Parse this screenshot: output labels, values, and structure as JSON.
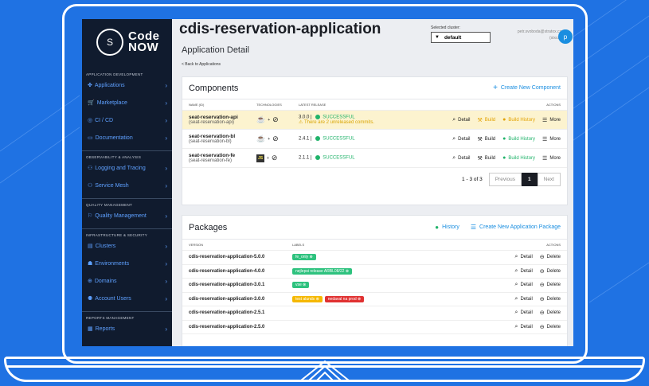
{
  "sidebar": {
    "logo_text_1": "Code",
    "logo_text_2": "NOW",
    "sections": [
      {
        "title": "APPLICATION DEVELOPMENT",
        "items": [
          {
            "label": "Applications",
            "icon": "applications-icon"
          },
          {
            "label": "Marketplace",
            "icon": "marketplace-icon"
          },
          {
            "label": "CI / CD",
            "icon": "cicd-icon"
          },
          {
            "label": "Documentation",
            "icon": "documentation-icon"
          }
        ]
      },
      {
        "title": "OBSERVABILITY & ANALYSIS",
        "items": [
          {
            "label": "Logging and Tracing",
            "icon": "logging-icon"
          },
          {
            "label": "Service Mesh",
            "icon": "service-mesh-icon"
          }
        ]
      },
      {
        "title": "QUALITY MANAGEMENT",
        "items": [
          {
            "label": "Quality Management",
            "icon": "quality-icon"
          }
        ]
      },
      {
        "title": "INFRASTRUCTURE & SECURITY",
        "items": [
          {
            "label": "Clusters",
            "icon": "clusters-icon"
          },
          {
            "label": "Environments",
            "icon": "environments-icon"
          },
          {
            "label": "Domains",
            "icon": "domains-icon"
          },
          {
            "label": "Account Users",
            "icon": "users-icon"
          }
        ]
      },
      {
        "title": "REPORTS MANAGEMENT",
        "items": [
          {
            "label": "Reports",
            "icon": "reports-icon"
          }
        ]
      }
    ]
  },
  "header": {
    "title": "cdis-reservation-application",
    "subtitle": "Application Detail",
    "back_link": "< Back to Applications",
    "cluster_label": "Selected cluster:",
    "cluster_value": "default",
    "user_email": "petr.svoboda@stratox.cz",
    "user_sub": "(stxcn)",
    "avatar_letter": "p"
  },
  "components": {
    "title": "Components",
    "create_label": "Create New Component",
    "columns": {
      "name": "NAME (ID)",
      "tech": "TECHNOLOGIES",
      "release": "LATEST RELEASE",
      "actions": "ACTIONS"
    },
    "rows": [
      {
        "name": "seat-reservation-api",
        "id": "(seat-reservation-api)",
        "version": "3.0.0",
        "status": "SUCCESSFUL",
        "warning": "There are 2 unreleased commits.",
        "highlight": true,
        "tech": "java"
      },
      {
        "name": "seat-reservation-bl",
        "id": "(seat-reservation-bl)",
        "version": "2.4.1",
        "status": "SUCCESSFUL",
        "warning": "",
        "highlight": false,
        "tech": "java"
      },
      {
        "name": "seat-reservation-fe",
        "id": "(seat-reservation-fe)",
        "version": "2.1.1",
        "status": "SUCCESSFUL",
        "warning": "",
        "highlight": false,
        "tech": "js"
      }
    ],
    "actions": {
      "detail": "Detail",
      "build": "Build",
      "history": "Build History",
      "more": "More"
    },
    "pager": {
      "count": "1 - 3 of 3",
      "previous": "Previous",
      "current": "1",
      "next": "Next"
    }
  },
  "packages": {
    "title": "Packages",
    "history_label": "History",
    "create_label": "Create New Application Package",
    "columns": {
      "version": "VERSION",
      "labels": "LABELS",
      "actions": "ACTIONS"
    },
    "rows": [
      {
        "version": "cdis-reservation-application-5.0.0",
        "labels": [
          {
            "text": "fe_only",
            "color": "g"
          }
        ]
      },
      {
        "version": "cdis-reservation-application-4.0.0",
        "labels": [
          {
            "text": "nejlepsi release ARBL08/22",
            "color": "g"
          }
        ]
      },
      {
        "version": "cdis-reservation-application-3.0.1",
        "labels": [
          {
            "text": "vse",
            "color": "g"
          }
        ]
      },
      {
        "version": "cdis-reservation-application-3.0.0",
        "labels": [
          {
            "text": "test alunds",
            "color": "y"
          },
          {
            "text": "nedaval na prod",
            "color": "r"
          }
        ]
      },
      {
        "version": "cdis-reservation-application-2.5.1",
        "labels": []
      },
      {
        "version": "cdis-reservation-application-2.5.0",
        "labels": []
      }
    ],
    "actions": {
      "detail": "Detail",
      "delete": "Delete"
    }
  }
}
